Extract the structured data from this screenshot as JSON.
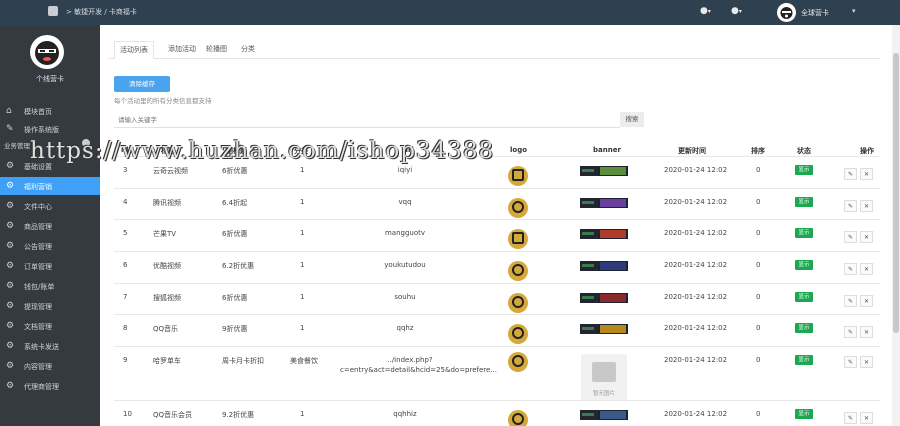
{
  "topbar": {
    "breadcrumb": "> 敏捷开发 / 卡商福卡",
    "bell_caret": "▾",
    "user_caret": "▾",
    "username": "全球营卡"
  },
  "sidebar": {
    "brand_name": "个线营卡",
    "section_label": "业务管理",
    "items": [
      {
        "label": "模块首页",
        "icon": "home-icon"
      },
      {
        "label": "操作系统版",
        "icon": "edit-icon"
      },
      {
        "label": "基础设置",
        "icon": "gear-icon"
      },
      {
        "label": "福利营销",
        "icon": "gear-icon"
      },
      {
        "label": "文件中心",
        "icon": "gear-icon"
      },
      {
        "label": "商品管理",
        "icon": "gear-icon"
      },
      {
        "label": "公告管理",
        "icon": "gear-icon"
      },
      {
        "label": "订单管理",
        "icon": "gear-icon"
      },
      {
        "label": "钱包/账单",
        "icon": "gear-icon"
      },
      {
        "label": "提现管理",
        "icon": "gear-icon"
      },
      {
        "label": "文档管理",
        "icon": "gear-icon"
      },
      {
        "label": "系统卡发送",
        "icon": "gear-icon"
      },
      {
        "label": "内容管理",
        "icon": "gear-icon"
      },
      {
        "label": "代理商管理",
        "icon": "gear-icon"
      }
    ],
    "active_index": 3
  },
  "tabs": [
    "活动列表",
    "添加活动",
    "轮播图",
    "分类"
  ],
  "clear_button": "清除缓存",
  "hint": "每个活动里的所有分类信息都支持",
  "search": {
    "placeholder": "请输入关键字",
    "button": "搜索"
  },
  "table": {
    "headers": [
      "id",
      "标题",
      "副标题",
      "分类",
      "url",
      "logo",
      "banner",
      "更新时间",
      "排序",
      "状态",
      "操作"
    ],
    "rows": [
      {
        "id": "3",
        "title": "云奇云视频",
        "subtitle": "6折优惠",
        "category": "1",
        "url": "iqiyi",
        "logo": "tv-logo",
        "time": "2020-01-24 12:02",
        "sort": "0",
        "status": "显示"
      },
      {
        "id": "4",
        "title": "腾讯视频",
        "subtitle": "6.4折起",
        "category": "1",
        "url": "vqq",
        "logo": "play-logo",
        "time": "2020-01-24 12:02",
        "sort": "0",
        "status": "显示"
      },
      {
        "id": "5",
        "title": "芒果TV",
        "subtitle": "6折优惠",
        "category": "1",
        "url": "mangguotv",
        "logo": "mango-logo",
        "time": "2020-01-24 12:02",
        "sort": "0",
        "status": "显示"
      },
      {
        "id": "6",
        "title": "优酷视频",
        "subtitle": "6.2折优惠",
        "category": "1",
        "url": "youkutudou",
        "logo": "youku-logo",
        "time": "2020-01-24 12:02",
        "sort": "0",
        "status": "显示"
      },
      {
        "id": "7",
        "title": "搜狐视频",
        "subtitle": "6折优惠",
        "category": "1",
        "url": "souhu",
        "logo": "play-logo",
        "time": "2020-01-24 12:02",
        "sort": "0",
        "status": "显示"
      },
      {
        "id": "8",
        "title": "QQ音乐",
        "subtitle": "9折优惠",
        "category": "1",
        "url": "qqhz",
        "logo": "music-logo",
        "time": "2020-01-24 12:02",
        "sort": "0",
        "status": "显示"
      },
      {
        "id": "9",
        "title": "哈罗单车",
        "subtitle": "周卡月卡折扣",
        "category": "美食餐饮",
        "url": "../index.php?c=entry&act=detail&hcid=25&do=prefere...",
        "logo": "bike-logo",
        "time": "2020-01-24 12:02",
        "sort": "0",
        "status": "显示",
        "no_banner": "暂无图片"
      },
      {
        "id": "10",
        "title": "QQ音乐会员",
        "subtitle": "9.2折优惠",
        "category": "1",
        "url": "qqhhiz",
        "logo": "music-logo",
        "time": "2020-01-24 12:02",
        "sort": "0",
        "status": "显示"
      }
    ]
  },
  "op_labels": {
    "edit": "✎",
    "delete": "✕"
  },
  "watermark": "https://www.huzhan.com/ishop34388",
  "colors": {
    "sidebar_bg": "#343a40",
    "topbar_bg": "#2f4050",
    "active": "#3ea0f6",
    "status_green": "#1aa94e",
    "logo_gold": "#d4a83a"
  }
}
